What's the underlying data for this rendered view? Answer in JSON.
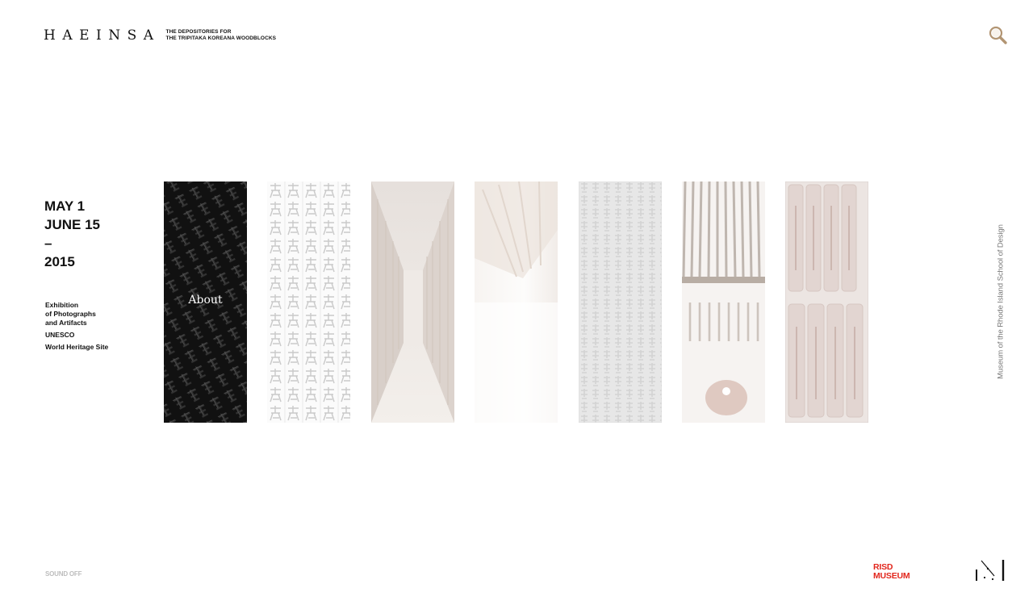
{
  "header": {
    "brand": "HAEINSA",
    "tagline_line1": "THE DEPOSITORIES FOR",
    "tagline_line2": "THE TRIPITAKA KOREANA WOODBLOCKS"
  },
  "search": {
    "icon": "magnifier-icon",
    "color": "#b29573"
  },
  "dates": [
    "MAY 1",
    "JUNE 15",
    "–",
    "2015"
  ],
  "info": {
    "exhibition_lines": [
      "Exhibition",
      "of Photographs",
      "and Artifacts"
    ],
    "unesco": "UNESCO",
    "heritage": "World Heritage Site"
  },
  "panels": [
    {
      "id": "about",
      "label": "About",
      "active": true
    },
    {
      "id": "calligraphy",
      "label": "",
      "active": false
    },
    {
      "id": "corridor",
      "label": "",
      "active": false
    },
    {
      "id": "hall",
      "label": "",
      "active": false
    },
    {
      "id": "woodblock",
      "label": "",
      "active": false
    },
    {
      "id": "window",
      "label": "",
      "active": false
    },
    {
      "id": "tablets",
      "label": "",
      "active": false
    }
  ],
  "footer": {
    "sound": "SOUND OFF",
    "museum_line1": "RISD",
    "museum_line2": "MUSEUM",
    "vertical_credit": "Museum of the Rhode Island School of Design"
  },
  "colors": {
    "accent": "#e2261c",
    "search": "#b29573"
  }
}
